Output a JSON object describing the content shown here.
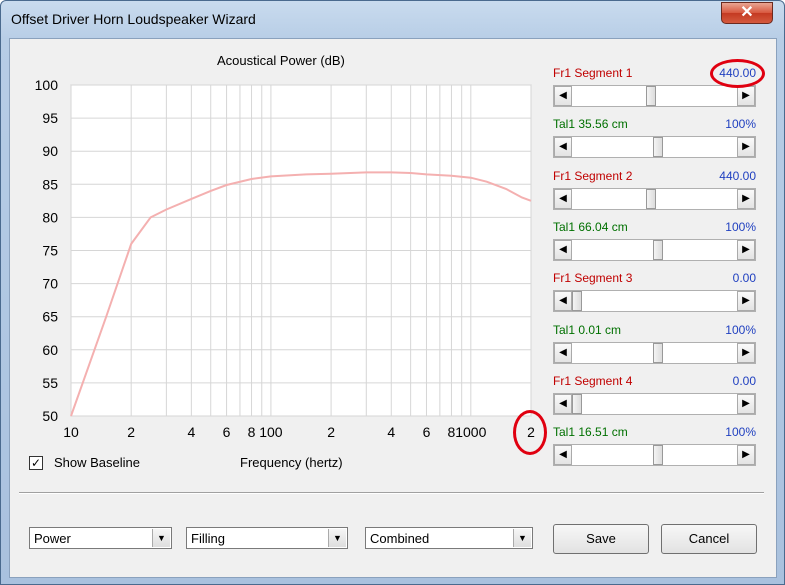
{
  "window": {
    "title": "Offset Driver Horn Loudspeaker Wizard",
    "close_glyph": "✕"
  },
  "chart_data": {
    "type": "line",
    "title": "Acoustical Power (dB)",
    "xlabel": "Frequency (hertz)",
    "ylabel": "",
    "x_scale": "log",
    "xlim": [
      10,
      2000
    ],
    "ylim": [
      50,
      100
    ],
    "x_tick_labels": [
      "10",
      "2",
      "4",
      "6",
      "8",
      "100",
      "2",
      "4",
      "6",
      "8",
      "1000",
      "2"
    ],
    "y_tick_labels": [
      "100",
      "95",
      "90",
      "85",
      "80",
      "75",
      "70",
      "65",
      "60",
      "55",
      "50"
    ],
    "grid": true,
    "series": [
      {
        "color": "#f4b0b0",
        "x": [
          10,
          15,
          20,
          25,
          30,
          40,
          50,
          60,
          80,
          100,
          150,
          200,
          300,
          400,
          500,
          600,
          800,
          1000,
          1200,
          1500,
          1800,
          2000
        ],
        "y": [
          50,
          65,
          76,
          80,
          81.2,
          82.8,
          84,
          84.9,
          85.8,
          86.2,
          86.5,
          86.6,
          86.8,
          86.8,
          86.7,
          86.5,
          86.3,
          86.0,
          85.4,
          84.3,
          83.0,
          82.5
        ]
      }
    ]
  },
  "show_baseline": {
    "label": "Show Baseline",
    "checked": true,
    "check_glyph": "✓"
  },
  "segments": [
    {
      "label": "Fr1  Segment 1",
      "value": "440.00",
      "label_color": "red",
      "thumb": 0.48
    },
    {
      "label": "Tal1  35.56 cm",
      "value": "100%",
      "label_color": "green",
      "thumb": 0.52
    },
    {
      "label": "Fr1  Segment 2",
      "value": "440.00",
      "label_color": "red",
      "thumb": 0.48
    },
    {
      "label": "Tal1  66.04 cm",
      "value": "100%",
      "label_color": "green",
      "thumb": 0.52
    },
    {
      "label": "Fr1  Segment 3",
      "value": "0.00",
      "label_color": "red",
      "thumb": 0.0
    },
    {
      "label": "Tal1  0.01 cm",
      "value": "100%",
      "label_color": "green",
      "thumb": 0.52
    },
    {
      "label": "Fr1  Segment 4",
      "value": "0.00",
      "label_color": "red",
      "thumb": 0.0
    },
    {
      "label": "Tal1  16.51 cm",
      "value": "100%",
      "label_color": "green",
      "thumb": 0.52
    }
  ],
  "dropdowns": [
    {
      "value": "Power"
    },
    {
      "value": "Filling"
    },
    {
      "value": "Combined"
    }
  ],
  "buttons": {
    "save": "Save",
    "cancel": "Cancel"
  },
  "icons": {
    "left_arrow": "◀",
    "right_arrow": "▶",
    "dropdown_arrow": "▼"
  },
  "annotations": {
    "circle_color": "#e00010"
  }
}
